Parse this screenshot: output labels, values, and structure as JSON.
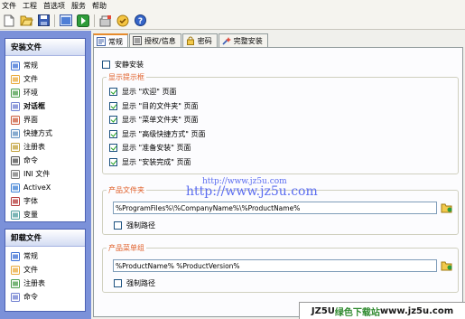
{
  "menu": [
    "文件",
    "工程",
    "首选项",
    "服务",
    "帮助"
  ],
  "toolbar": {
    "buttons": [
      "new-icon",
      "open-icon",
      "save-icon",
      "build-icon",
      "run-icon",
      "setup-icon",
      "wizard-icon",
      "help-icon"
    ]
  },
  "nav_install": {
    "title": "安装文件",
    "items": [
      {
        "label": "常规",
        "icon": "general-icon"
      },
      {
        "label": "文件",
        "icon": "folder-icon"
      },
      {
        "label": "环境",
        "icon": "environment-icon"
      },
      {
        "label": "对话框",
        "icon": "dialog-icon",
        "active": true
      },
      {
        "label": "界面",
        "icon": "interface-icon"
      },
      {
        "label": "快捷方式",
        "icon": "shortcut-icon"
      },
      {
        "label": "注册表",
        "icon": "registry-icon"
      },
      {
        "label": "命令",
        "icon": "command-icon"
      },
      {
        "label": "INI 文件",
        "icon": "ini-icon"
      },
      {
        "label": "ActiveX",
        "icon": "activex-icon"
      },
      {
        "label": "字体",
        "icon": "font-icon"
      },
      {
        "label": "变量",
        "icon": "variable-icon"
      }
    ]
  },
  "nav_uninstall": {
    "title": "卸载文件",
    "items": [
      {
        "label": "常规",
        "icon": "general-icon"
      },
      {
        "label": "文件",
        "icon": "folder-icon"
      },
      {
        "label": "注册表",
        "icon": "registry-icon"
      },
      {
        "label": "命令",
        "icon": "command-icon"
      }
    ]
  },
  "tabs": [
    {
      "label": "常规",
      "active": true
    },
    {
      "label": "授权/信息"
    },
    {
      "label": "密码"
    },
    {
      "label": "完整安装"
    }
  ],
  "silent_install": {
    "label": "安静安装",
    "checked": false
  },
  "dialogs_group": {
    "title": "显示提示框",
    "items": [
      {
        "label": "显示 \"欢迎\" 页面",
        "checked": true
      },
      {
        "label": "显示 \"目的文件夹\" 页面",
        "checked": true
      },
      {
        "label": "显示 \"菜单文件夹\" 页面",
        "checked": true
      },
      {
        "label": "显示 \"高级快捷方式\" 页面",
        "checked": true
      },
      {
        "label": "显示 \"准备安装\" 页面",
        "checked": true
      },
      {
        "label": "显示 \"安装完成\" 页面",
        "checked": true
      }
    ]
  },
  "product_folder": {
    "title": "产品文件夹",
    "value": "%ProgramFiles%\\%CompanyName%\\%ProductName%",
    "force_label": "强制路径",
    "force_checked": false
  },
  "product_menu": {
    "title": "产品菜单组",
    "value": "%ProductName% %ProductVersion%",
    "force_label": "强制路径",
    "force_checked": false
  },
  "watermark": {
    "small": "http://www.jz5u.com",
    "large": "http://www.jz5u.com"
  },
  "badge": {
    "left": "JZ5U",
    "mid": "绿色下载站",
    "right": "www.jz5u.com"
  }
}
